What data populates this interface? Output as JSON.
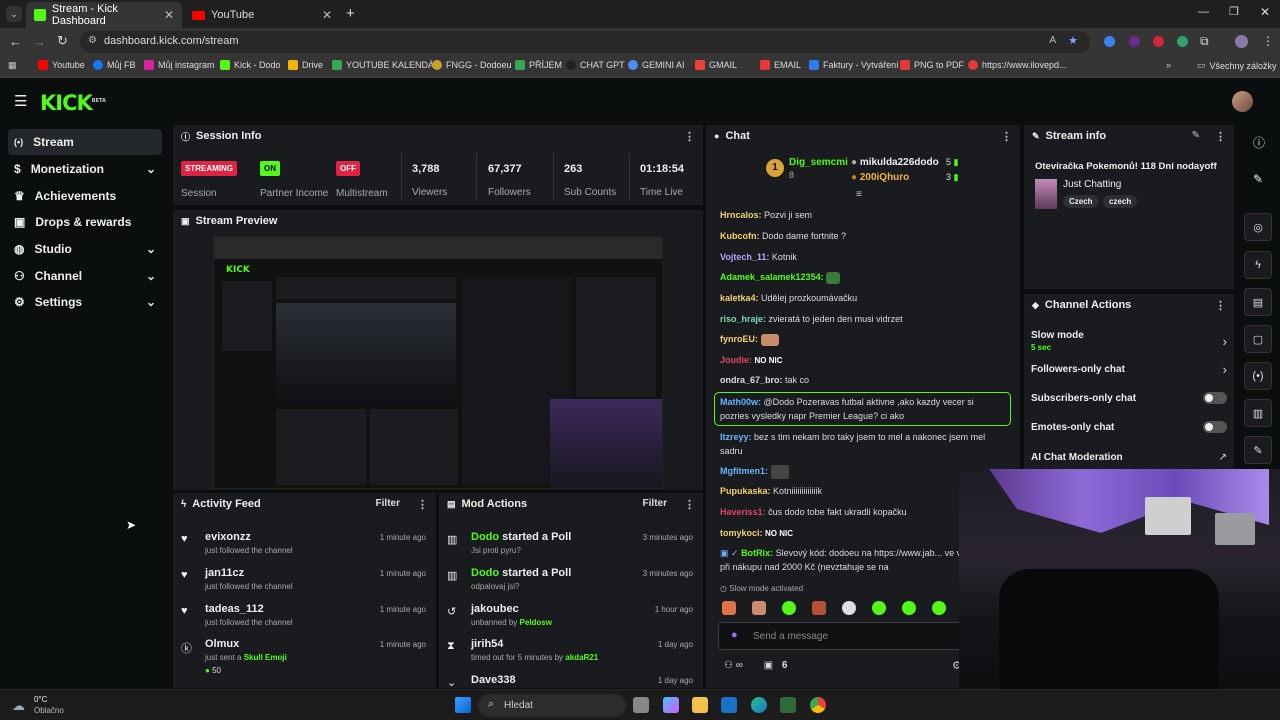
{
  "browser": {
    "tabs": [
      {
        "title": "Stream - Kick Dashboard",
        "active": true
      },
      {
        "title": "YouTube",
        "active": false
      }
    ],
    "url": "dashboard.kick.com/stream",
    "bookmarks": [
      "Youtube",
      "Můj FB",
      "Můj instagram",
      "Kick - Dodo",
      "Drive",
      "YOUTUBE KALENDÁŘ",
      "FNGG - Dodoeu",
      "PŘÍJEM",
      "CHAT GPT",
      "GEMINI AI",
      "GMAIL",
      "EMAIL",
      "Faktury - Vytváření",
      "PNG to PDF",
      "https://www.ilovepd..."
    ],
    "all_bookmarks": "Všechny záložky"
  },
  "app": {
    "logo": "KICK",
    "logo_tag": "BETA",
    "accent": "#53fc18"
  },
  "sidebar": {
    "items": [
      {
        "label": "Stream",
        "icon": "broadcast-icon"
      },
      {
        "label": "Monetization",
        "icon": "dollar-icon"
      },
      {
        "label": "Achievements",
        "icon": "trophy-icon"
      },
      {
        "label": "Drops & rewards",
        "icon": "gift-icon"
      },
      {
        "label": "Studio",
        "icon": "globe-icon"
      },
      {
        "label": "Channel",
        "icon": "people-icon"
      },
      {
        "label": "Settings",
        "icon": "gear-icon"
      }
    ]
  },
  "session": {
    "title": "Session Info",
    "stats": [
      {
        "badge": "STREAMING",
        "label": "Session"
      },
      {
        "badge": "ON",
        "label": "Partner Income"
      },
      {
        "badge": "OFF",
        "label": "Multistream"
      },
      {
        "value": "3,788",
        "label": "Viewers"
      },
      {
        "value": "67,377",
        "label": "Followers"
      },
      {
        "value": "263",
        "label": "Sub Counts"
      },
      {
        "value": "01:18:54",
        "label": "Time Live"
      }
    ]
  },
  "preview": {
    "title": "Stream Preview"
  },
  "activity": {
    "title": "Activity Feed",
    "filter": "Filter",
    "items": [
      {
        "name": "evixonzz",
        "desc": "just followed the channel",
        "time": "1 minute ago"
      },
      {
        "name": "jan11cz",
        "desc": "just followed the channel",
        "time": "1 minute ago"
      },
      {
        "name": "tadeas_112",
        "desc": "just followed the channel",
        "time": "1 minute ago"
      },
      {
        "name": "Olmux",
        "desc": "just sent a",
        "extra": "Skull Emoji",
        "amount": "50",
        "time": "1 minute ago"
      }
    ]
  },
  "mod": {
    "title": "Mod Actions",
    "filter": "Filter",
    "items": [
      {
        "name": "Dodo",
        "action": "started a Poll",
        "desc": "Jsi proti pyru?",
        "time": "3 minutes ago"
      },
      {
        "name": "Dodo",
        "action": "started a Poll",
        "desc": "odpalovaj jsi?",
        "time": "3 minutes ago"
      },
      {
        "name": "jakoubec",
        "desc": "unbanned by",
        "by": "Peldosw",
        "time": "1 hour ago"
      },
      {
        "name": "jirih54",
        "desc": "timed out for 5 minutes by",
        "by": "akdaR21",
        "time": "1 day ago"
      },
      {
        "name": "Dave338",
        "desc": "",
        "time": "1 day ago"
      }
    ]
  },
  "chat": {
    "title": "Chat",
    "top": [
      {
        "rank": "1",
        "name": "Dig_semcmi",
        "count": "8"
      },
      {
        "name": "mikulda226dodo",
        "count": "5"
      },
      {
        "name": "200iQhuro",
        "count": "3"
      }
    ],
    "messages": [
      {
        "user": "Hrncalos:",
        "text": "Pozvi ji sem",
        "color": "#f3d26b"
      },
      {
        "user": "Kubcofn:",
        "text": "Dodo dame fortnite ?",
        "color": "#f3d26b"
      },
      {
        "user": "Vojtech_11:",
        "text": "Kotnik",
        "color": "#b7a3ff"
      },
      {
        "user": "Adamek_salamek12354:",
        "text": "",
        "color": "#53fc18"
      },
      {
        "user": "kaletka4:",
        "text": "Udělej prozkoumávačku",
        "color": "#f3d26b"
      },
      {
        "user": "riso_hraje:",
        "text": "zvieratá to jeden den musi vidrzet",
        "color": "#7fd6b6"
      },
      {
        "user": "fynroEU:",
        "text": "",
        "color": "#f3d26b"
      },
      {
        "user": "Joudie:",
        "text": "NO NIC",
        "color": "#e0466a"
      },
      {
        "user": "ondra_67_bro:",
        "text": "tak co",
        "color": "#ddd"
      },
      {
        "user": "Math00w:",
        "text": "@Dodo Pozeravas futbal aktivne ,ako kazdy vecer si pozries vysledky napr Premier League? ci ako",
        "color": "#6ab4ff"
      },
      {
        "user": "Itzreyy:",
        "text": "bez s tim nekam bro taky jsem to mel a nakonec jsem mel sadru",
        "color": "#6ab4ff"
      },
      {
        "user": "Mgfitmen1:",
        "text": "",
        "color": "#6ab4ff"
      },
      {
        "user": "Pupukaska:",
        "text": "Kotniiiiiiiiiiiiik",
        "color": "#f3d26b"
      },
      {
        "user": "Haveriss1:",
        "text": "čus dodo tobe fakt ukradli kopačku",
        "color": "#e0466a"
      },
      {
        "user": "tomykoci:",
        "text": "NO NIC",
        "color": "#f3d26b"
      },
      {
        "user": "BotRix:",
        "text": "Slevový kód: dodoeu na https://www.jab... ve výši 600 Kč, při nákupu nad 2000 Kč (nevztahuje se na",
        "color": "#53fc18"
      }
    ],
    "slow_mode_note": "Slow mode activated",
    "input_placeholder": "Send a message",
    "footer_count": "6"
  },
  "stream_info": {
    "title": "Stream info",
    "stream_title": "Otevíračka Pokemonů! 118 Dní nodayoff",
    "category": "Just Chatting",
    "tags": [
      "Czech",
      "czech"
    ]
  },
  "channel_actions": {
    "title": "Channel Actions",
    "items": [
      {
        "label": "Slow mode",
        "sub": "5 sec",
        "type": "link"
      },
      {
        "label": "Followers-only chat",
        "type": "link"
      },
      {
        "label": "Subscribers-only chat",
        "type": "toggle"
      },
      {
        "label": "Emotes-only chat",
        "type": "toggle"
      },
      {
        "label": "AI Chat Moderation",
        "type": "external"
      }
    ]
  },
  "taskbar": {
    "weather_temp": "0°C",
    "weather_desc": "Oblačno",
    "search_placeholder": "Hledat"
  }
}
